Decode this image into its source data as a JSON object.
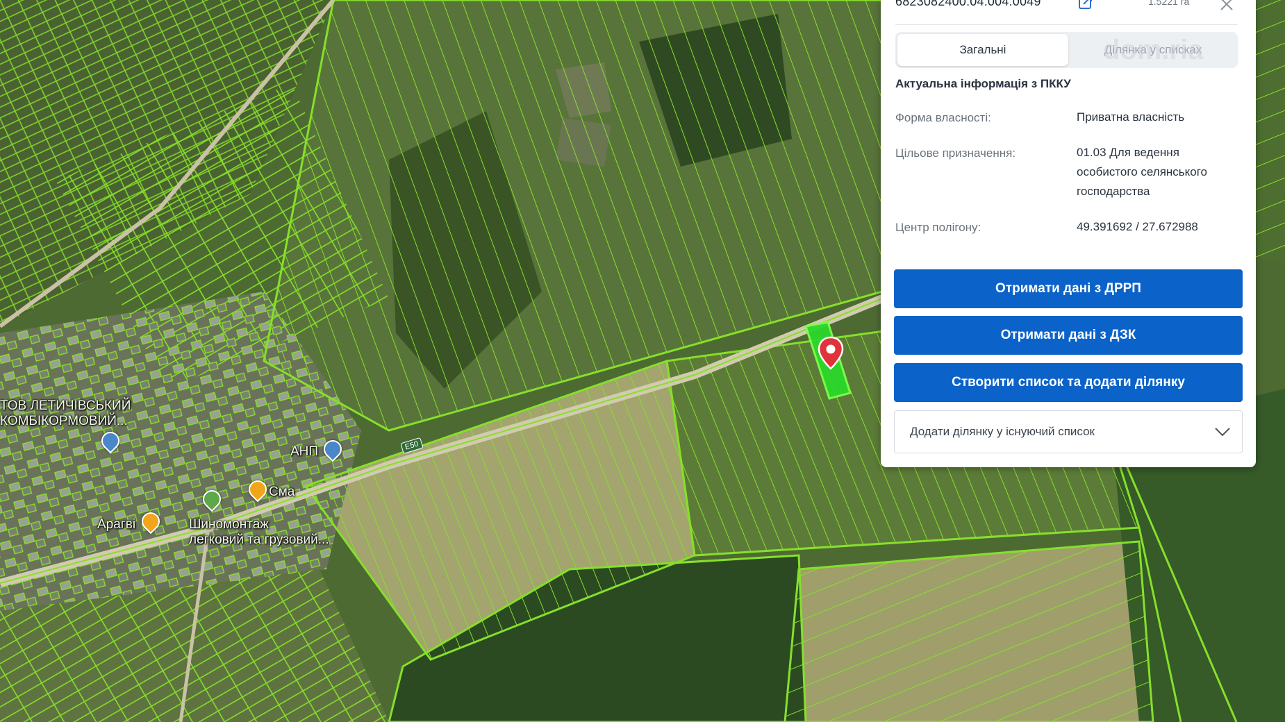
{
  "map": {
    "labels": {
      "company": "ТОВ ЛЕТИЧІВСЬКИЙ КОМБІКОРМОВИЙ...",
      "anp": "АНП",
      "sma": "Сма",
      "aragvi": "Арагві",
      "tire_service_line1": "Шиномонтаж",
      "tire_service_line2": "легковий та грузовий...",
      "road": "E50"
    },
    "colors": {
      "parcel_outline": "#86e02a",
      "selected_parcel": "#2bd82b",
      "marker": "#e0323a"
    }
  },
  "panel": {
    "cadastral_number": "6823082400:04:004:0049",
    "area": "1.5221 га",
    "tabs": [
      {
        "label": "Загальні",
        "active": true
      },
      {
        "label": "Ділянка у списках",
        "active": false
      }
    ],
    "watermark": "dom.ria",
    "info_title": "Актуальна інформація з ПККУ",
    "rows": [
      {
        "label": "Форма власності:",
        "value": "Приватна власність"
      },
      {
        "label": "Цільове призначення:",
        "value": "01.03 Для ведення особистого селянського господарства"
      },
      {
        "label": "Центр полігону:",
        "value": "49.391692 / 27.672988"
      }
    ],
    "buttons": {
      "drrp": "Отримати дані з ДРРП",
      "dzk": "Отримати дані з ДЗК",
      "create_list": "Створити список та додати ділянку"
    },
    "add_to_list": "Додати ділянку у існуючий список",
    "accent_color": "#0b63c9"
  }
}
